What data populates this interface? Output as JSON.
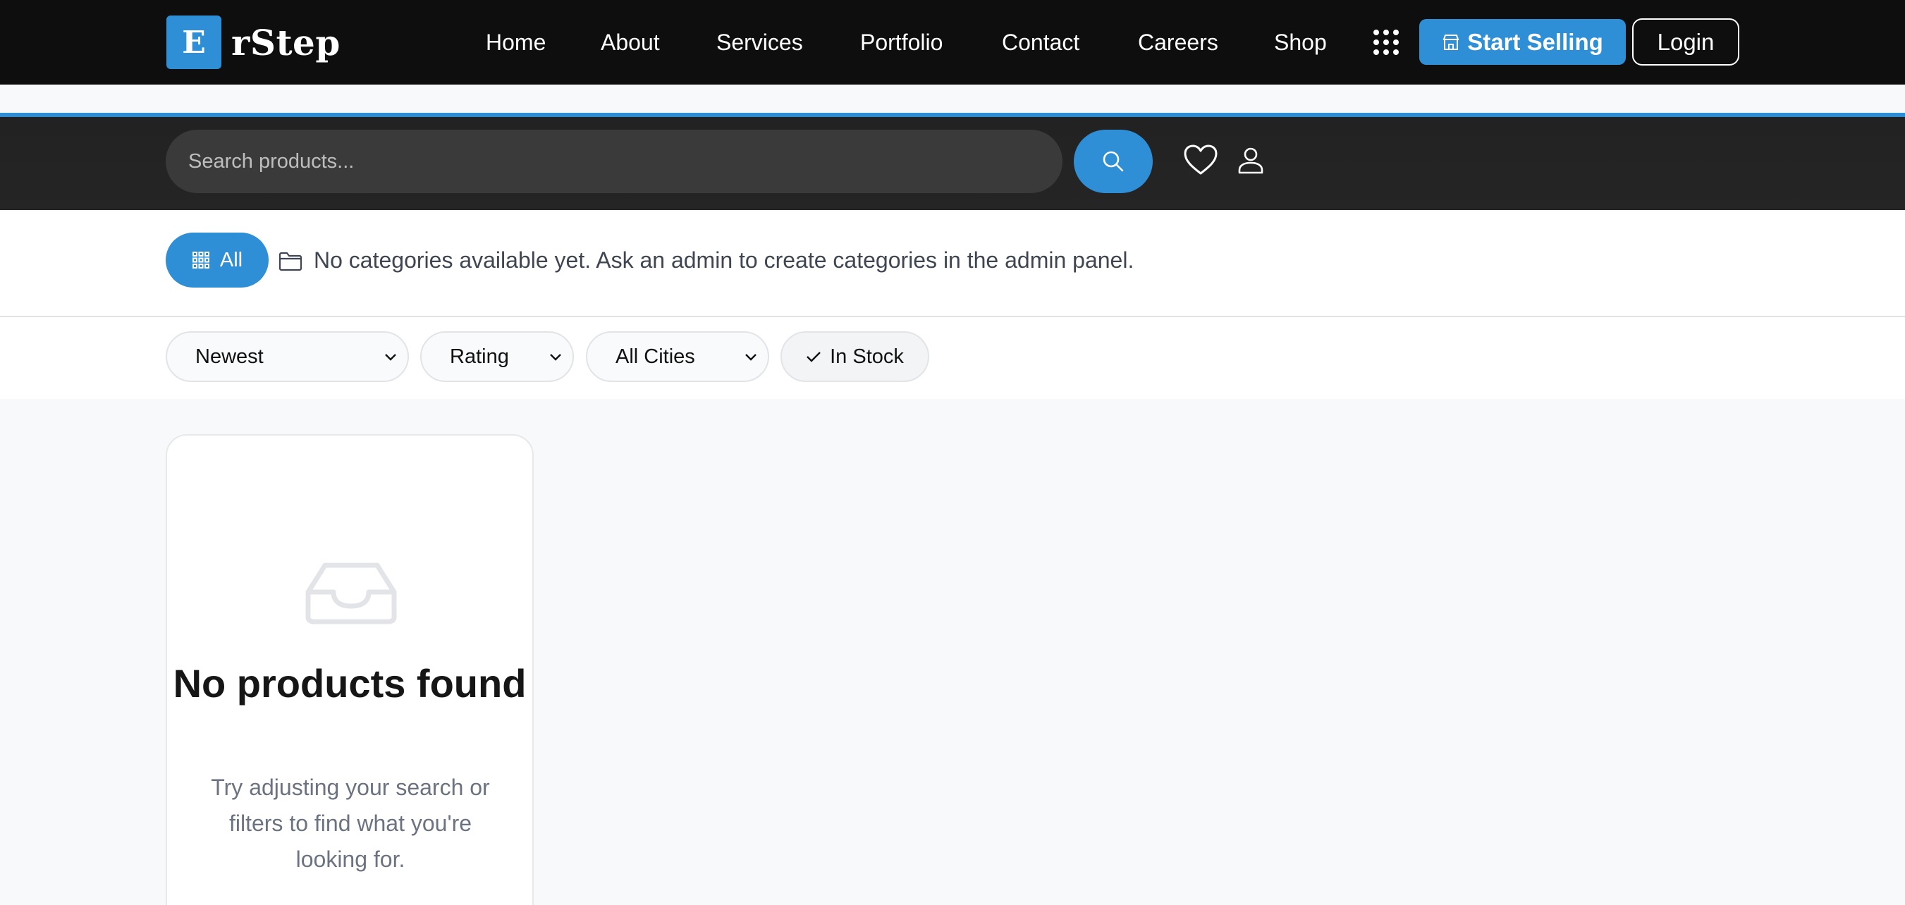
{
  "brand": {
    "logo_letter": "E",
    "name": "rStep"
  },
  "nav": {
    "links": [
      "Home",
      "About",
      "Services",
      "Portfolio",
      "Contact",
      "Careers",
      "Shop"
    ],
    "start_selling": "Start Selling",
    "login": "Login"
  },
  "search": {
    "placeholder": "Search products..."
  },
  "categories": {
    "all_label": "All",
    "message": "No categories available yet. Ask an admin to create categories in the admin panel."
  },
  "filters": {
    "sort": "Newest",
    "rating": "Rating",
    "city": "All Cities",
    "in_stock": "In Stock"
  },
  "empty": {
    "title": "No products found",
    "subtitle": "Try adjusting your search or filters to find what you're looking for."
  },
  "colors": {
    "accent": "#2f8fd6",
    "nav_bg": "#0e0e0e",
    "search_bg": "#252525"
  },
  "icons": [
    "apps-grid-icon",
    "store-icon",
    "search-icon",
    "heart-icon",
    "user-icon",
    "grid-icon",
    "folder-icon",
    "chevron-down-icon",
    "check-icon",
    "inbox-icon"
  ]
}
